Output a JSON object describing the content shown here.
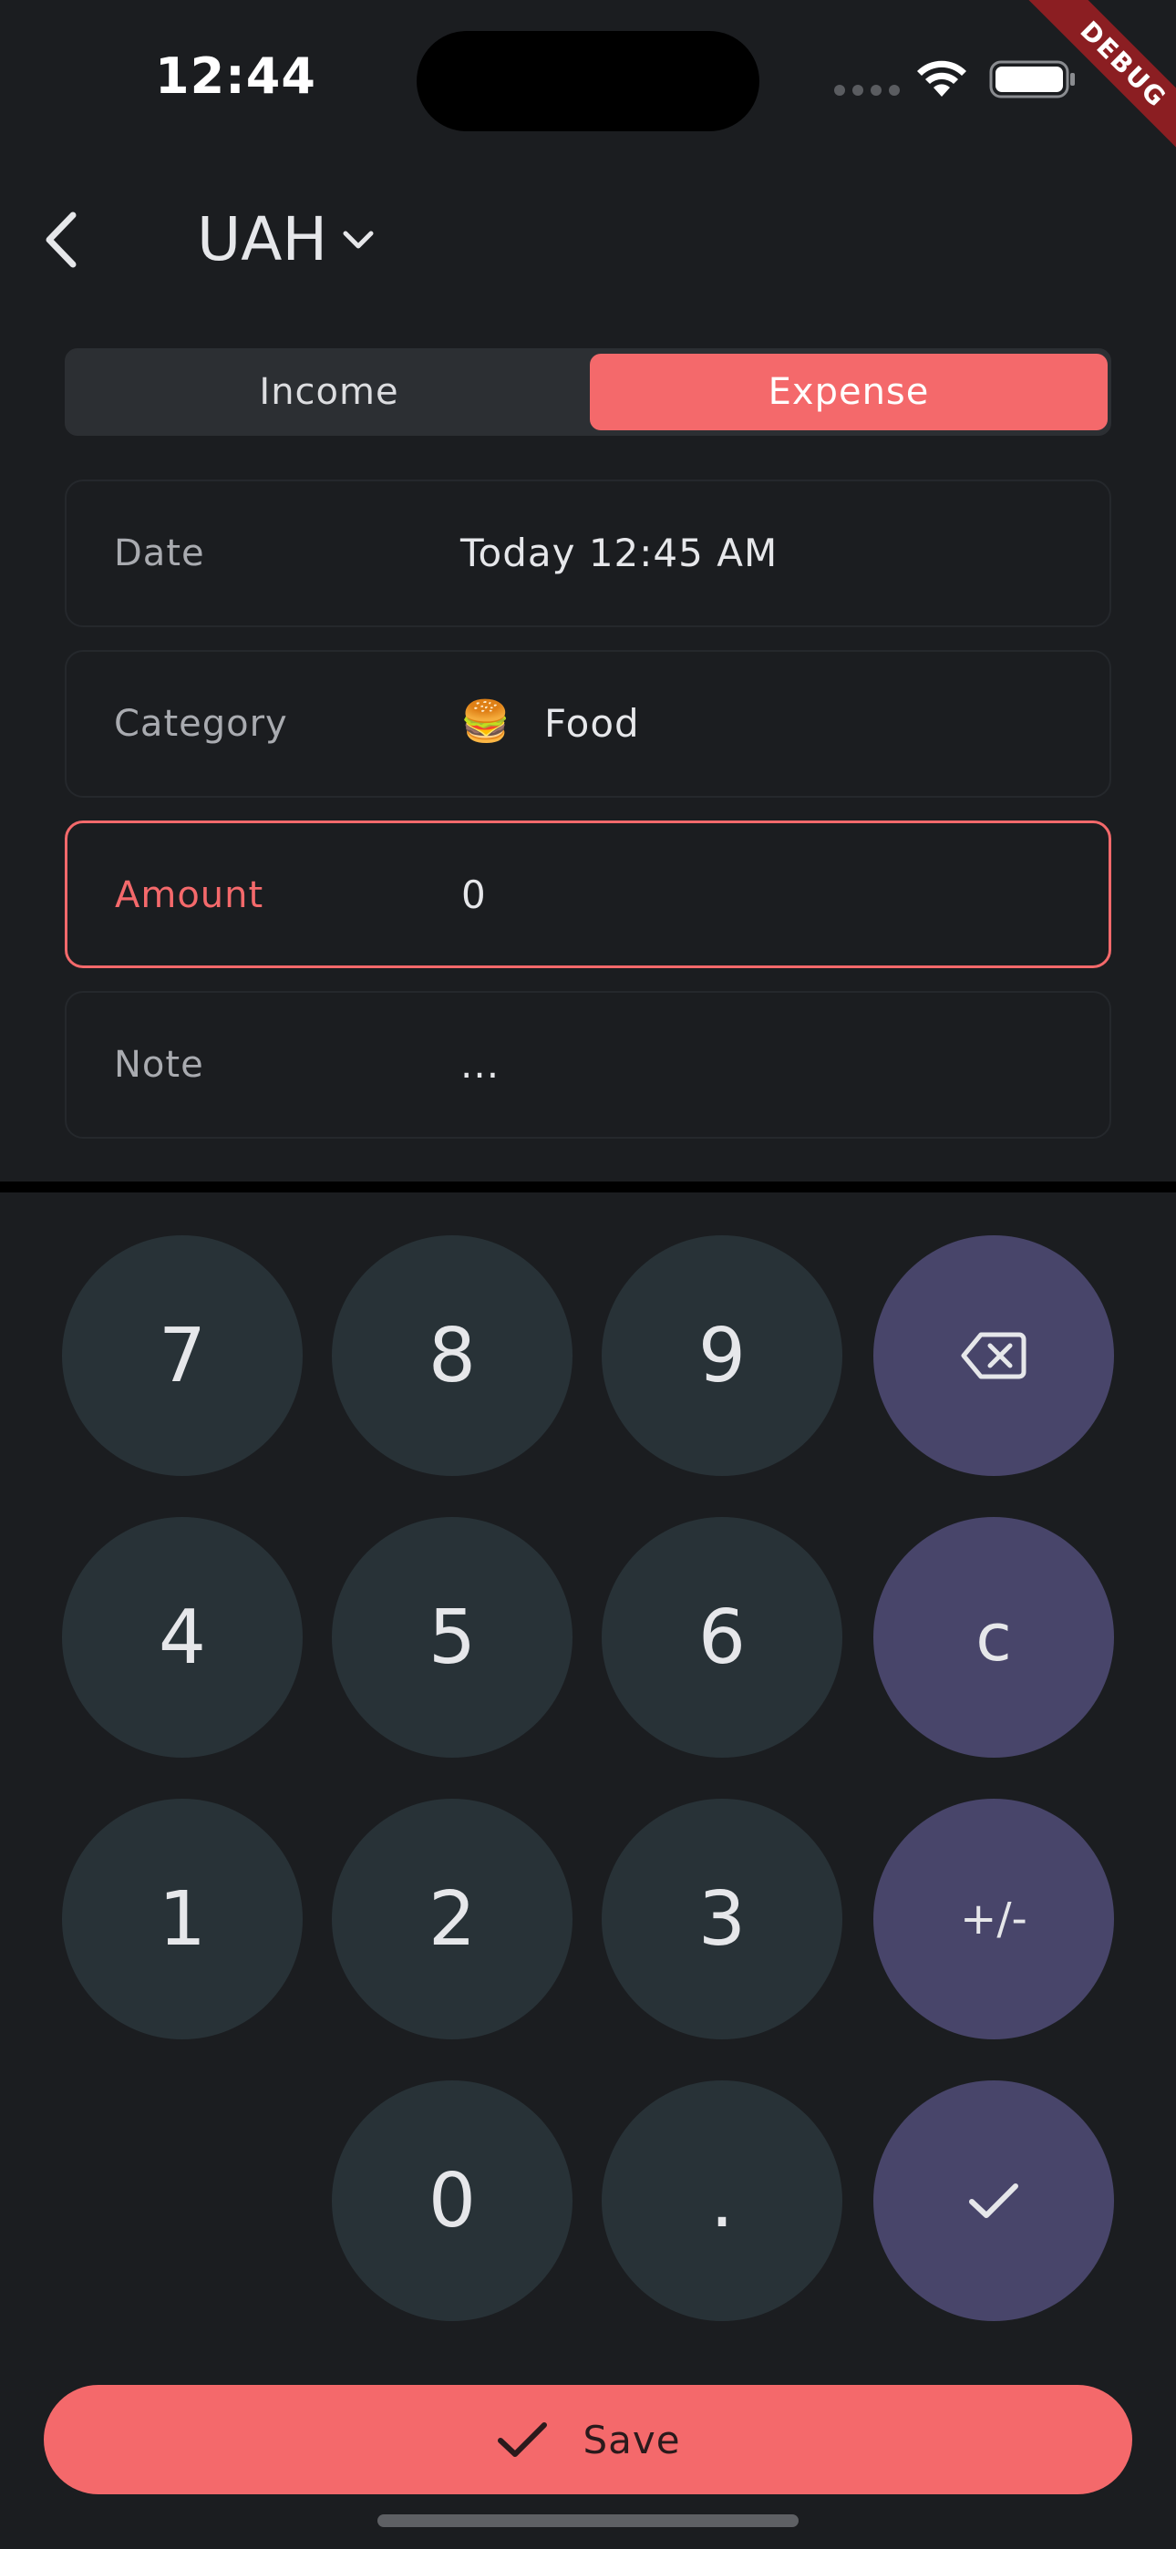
{
  "status_bar": {
    "time": "12:44",
    "debug_banner": "DEBUG"
  },
  "header": {
    "currency": "UAH"
  },
  "type_toggle": {
    "income_label": "Income",
    "expense_label": "Expense",
    "selected": "Expense"
  },
  "form": {
    "date": {
      "label": "Date",
      "value": "Today 12:45 AM"
    },
    "category": {
      "label": "Category",
      "emoji": "🍔",
      "value": "Food"
    },
    "amount": {
      "label": "Amount",
      "value": "0"
    },
    "note": {
      "label": "Note",
      "value": "..."
    }
  },
  "keypad": {
    "row1": [
      "7",
      "8",
      "9"
    ],
    "row2": [
      "4",
      "5",
      "6"
    ],
    "row3": [
      "1",
      "2",
      "3"
    ],
    "row4": [
      "0",
      "."
    ],
    "clear": "c",
    "sign": "+/-"
  },
  "save_button": {
    "label": "Save"
  },
  "colors": {
    "accent": "#f4696b",
    "key": "#283237",
    "function_key": "#48456a",
    "background": "#1b1d20"
  }
}
